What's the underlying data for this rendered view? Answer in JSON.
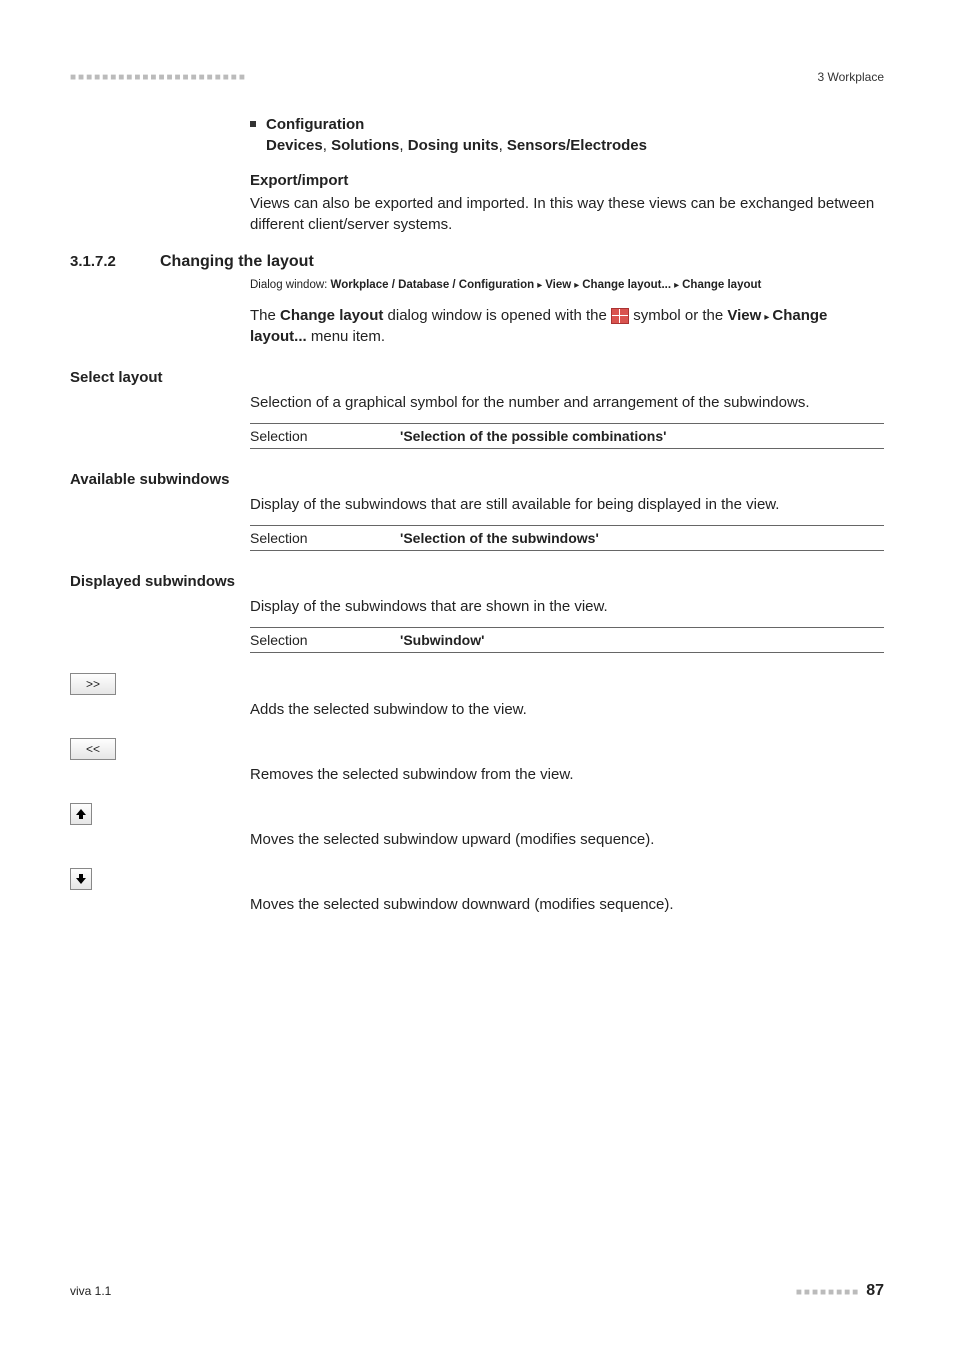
{
  "header": {
    "dots": "■■■■■■■■■■■■■■■■■■■■■■",
    "chapter": "3 Workplace"
  },
  "config": {
    "title": "Configuration",
    "subline": "Devices, Solutions, Dosing units, Sensors/Electrodes",
    "sub_parts": [
      "Devices",
      "Solutions",
      "Dosing units",
      "Sensors/Electrodes"
    ]
  },
  "export": {
    "title": "Export/import",
    "text": "Views can also be exported and imported. In this way these views can be exchanged between different client/server systems."
  },
  "section": {
    "num": "3.1.7.2",
    "title": "Changing the layout",
    "dialog_prefix": "Dialog window: ",
    "path1a": "Workplace / Database / Configuration",
    "path1b": "View",
    "path1c": "Change layout...",
    "path1d": "Change layout",
    "open_text_1": "The ",
    "open_bold_1": "Change layout",
    "open_text_2": " dialog window is opened with the ",
    "open_text_3": " symbol or the ",
    "open_bold_2": "View",
    "open_bold_3": "Change layout...",
    "open_text_4": " menu item."
  },
  "select_layout": {
    "heading": "Select layout",
    "text": "Selection of a graphical symbol for the number and arrangement of the subwindows.",
    "sel_label": "Selection",
    "sel_value": "'Selection of the possible combinations'"
  },
  "available": {
    "heading": "Available subwindows",
    "text": "Display of the subwindows that are still available for being displayed in the view.",
    "sel_label": "Selection",
    "sel_value": "'Selection of the subwindows'"
  },
  "displayed": {
    "heading": "Displayed subwindows",
    "text": "Display of the subwindows that are shown in the view.",
    "sel_label": "Selection",
    "sel_value": "'Subwindow'"
  },
  "buttons": {
    "add": {
      "label": ">>",
      "desc": "Adds the selected subwindow to the view."
    },
    "remove": {
      "label": "<<",
      "desc": "Removes the selected subwindow from the view."
    },
    "up": {
      "label": "↑",
      "desc": "Moves the selected subwindow upward (modifies sequence)."
    },
    "down": {
      "label": "↓",
      "desc": "Moves the selected subwindow downward (modifies sequence)."
    }
  },
  "footer": {
    "left": "viva 1.1",
    "dots": "■■■■■■■■",
    "page": "87"
  }
}
